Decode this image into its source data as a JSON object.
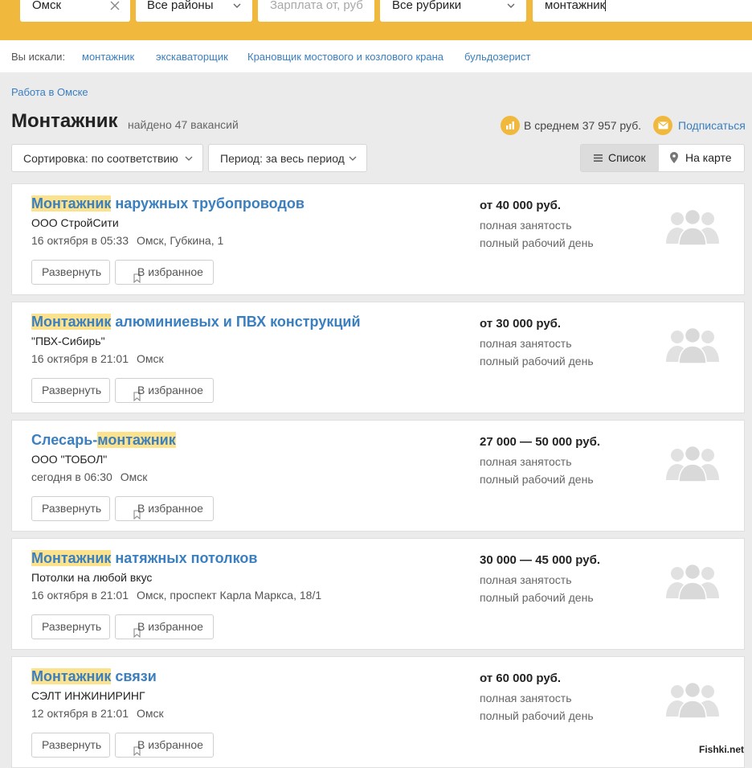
{
  "search": {
    "city": "Омск",
    "district": "Все районы",
    "salary_placeholder": "Зарплата от, руб",
    "rubric": "Все рубрики",
    "query": "монтажник"
  },
  "searched": {
    "label": "Вы искали:",
    "items": [
      "монтажник",
      "экскаваторщик",
      "Крановщик мостового и козлового крана",
      "бульдозерист"
    ]
  },
  "breadcrumb": "Работа в Омске",
  "page": {
    "title": "Монтажник",
    "found": "найдено 47 вакансий",
    "average": "В среднем 37 957 руб.",
    "subscribe": "Подписаться"
  },
  "controls": {
    "sort": "Сортировка: по соответствию",
    "period": "Период: за весь период",
    "list": "Список",
    "map": "На карте"
  },
  "buttons": {
    "expand": "Развернуть",
    "favorite": "В избранное"
  },
  "jobs": [
    {
      "title_hl": "Монтажник",
      "title_rest": " наружных трубопроводов",
      "company": "ООО СтройСити",
      "date": "16 октября в 05:33",
      "location": "Омск, Губкина, 1",
      "salary": "от 40 000 руб.",
      "employment": "полная занятость",
      "schedule": "полный рабочий день"
    },
    {
      "title_hl": "Монтажник",
      "title_rest": " алюминиевых и ПВХ конструкций",
      "company": "\"ПВХ-Сибирь\"",
      "date": "16 октября в 21:01",
      "location": "Омск",
      "salary": "от 30 000 руб.",
      "employment": "полная занятость",
      "schedule": "полный рабочий день"
    },
    {
      "title_pre": "Слесарь-",
      "title_hl": "монтажник",
      "title_rest": "",
      "company": "ООО \"ТОБОЛ\"",
      "date": "сегодня в 06:30",
      "location": "Омск",
      "salary": "27 000 — 50 000 руб.",
      "employment": "полная занятость",
      "schedule": "полный рабочий день"
    },
    {
      "title_hl": "Монтажник",
      "title_rest": " натяжных потолков",
      "company": "Потолки на любой вкус",
      "date": "16 октября в 21:01",
      "location": "Омск, проспект Карла Маркса, 18/1",
      "salary": "30 000 — 45 000 руб.",
      "employment": "полная занятость",
      "schedule": "полный рабочий день"
    },
    {
      "title_hl": "Монтажник",
      "title_rest": " связи",
      "company": "СЭЛТ ИНЖИНИРИНГ",
      "date": "12 октября в 21:01",
      "location": "Омск",
      "salary": "от 60 000 руб.",
      "employment": "полная занятость",
      "schedule": "полный рабочий день"
    }
  ],
  "watermark": "Fishki.net",
  "colors": {
    "accent": "#f0b93e",
    "link": "#3a7fc0",
    "highlight": "#fce28c"
  }
}
